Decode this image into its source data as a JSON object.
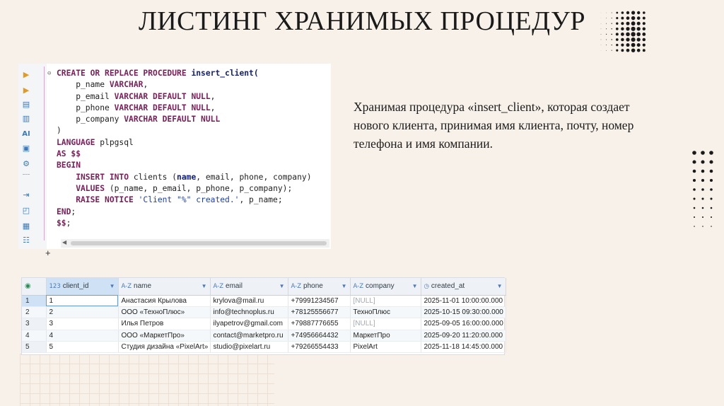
{
  "slide": {
    "title": "ЛИСТИНГ ХРАНИМЫХ ПРОЦЕДУР",
    "description": "Хранимая процедура «insert_client», которая создает нового клиента, принимая имя клиента, почту, номер телефона и имя компании."
  },
  "editor": {
    "toolbar_icons": [
      "execute-statement-icon",
      "execute-script-icon",
      "explain-plan-icon",
      "load-plan-icon",
      "ai-assistant-icon",
      "output-console-icon",
      "settings-icon",
      "export-icon",
      "variables-icon",
      "log-icon",
      "outline-icon"
    ],
    "ai_label": "AI",
    "code_lines": [
      [
        {
          "t": "CREATE OR REPLACE PROCEDURE ",
          "c": "kw"
        },
        {
          "t": "insert_client(",
          "c": "hl"
        }
      ],
      [
        {
          "t": "    p_name ",
          "c": "id"
        },
        {
          "t": "VARCHAR",
          "c": "kw"
        },
        {
          "t": ",",
          "c": "id"
        }
      ],
      [
        {
          "t": "    p_email ",
          "c": "id"
        },
        {
          "t": "VARCHAR DEFAULT NULL",
          "c": "kw"
        },
        {
          "t": ",",
          "c": "id"
        }
      ],
      [
        {
          "t": "    p_phone ",
          "c": "id"
        },
        {
          "t": "VARCHAR DEFAULT NULL",
          "c": "kw"
        },
        {
          "t": ",",
          "c": "id"
        }
      ],
      [
        {
          "t": "    p_company ",
          "c": "id"
        },
        {
          "t": "VARCHAR DEFAULT NULL",
          "c": "kw"
        }
      ],
      [
        {
          "t": ")",
          "c": "id"
        }
      ],
      [
        {
          "t": "LANGUAGE ",
          "c": "kw"
        },
        {
          "t": "plpgsql",
          "c": "id"
        }
      ],
      [
        {
          "t": "AS ",
          "c": "kw"
        },
        {
          "t": "$$",
          "c": "kw"
        }
      ],
      [
        {
          "t": "BEGIN",
          "c": "kw"
        }
      ],
      [
        {
          "t": "    INSERT INTO ",
          "c": "kw"
        },
        {
          "t": "clients (",
          "c": "id"
        },
        {
          "t": "name",
          "c": "hl"
        },
        {
          "t": ", email, phone, company)",
          "c": "id"
        }
      ],
      [
        {
          "t": "    VALUES ",
          "c": "kw"
        },
        {
          "t": "(p_name, p_email, p_phone, p_company);",
          "c": "id"
        }
      ],
      [
        {
          "t": "    RAISE NOTICE ",
          "c": "kw"
        },
        {
          "t": "'Client \"%\" created.'",
          "c": "str"
        },
        {
          "t": ", p_name;",
          "c": "id"
        }
      ],
      [
        {
          "t": "END",
          "c": "kw"
        },
        {
          "t": ";",
          "c": "id"
        }
      ],
      [
        {
          "t": "$$",
          "c": "kw"
        },
        {
          "t": ";",
          "c": "id"
        }
      ]
    ],
    "plus_mark": "+"
  },
  "result_grid": {
    "columns": [
      {
        "type": "123",
        "name": "client_id",
        "sorted": true
      },
      {
        "type": "A-Z",
        "name": "name"
      },
      {
        "type": "A-Z",
        "name": "email"
      },
      {
        "type": "A-Z",
        "name": "phone"
      },
      {
        "type": "A-Z",
        "name": "company"
      },
      {
        "type": "clock",
        "name": "created_at"
      }
    ],
    "rows": [
      {
        "n": "1",
        "cells": [
          "1",
          "Анастасия Крылова",
          "krylova@mail.ru",
          "+79991234567",
          "[NULL]",
          "2025-11-01 10:00:00.000"
        ]
      },
      {
        "n": "2",
        "cells": [
          "2",
          "ООО «ТехноПлюс»",
          "info@technoplus.ru",
          "+78125556677",
          "ТехноПлюс",
          "2025-10-15 09:30:00.000"
        ]
      },
      {
        "n": "3",
        "cells": [
          "3",
          "Илья Петров",
          "ilyapetrov@gmail.com",
          "+79887776655",
          "[NULL]",
          "2025-09-05 16:00:00.000"
        ]
      },
      {
        "n": "4",
        "cells": [
          "4",
          "ООО «МаркетПро»",
          "contact@marketpro.ru",
          "+74956664432",
          "МаркетПро",
          "2025-09-20 11:20:00.000"
        ]
      },
      {
        "n": "5",
        "cells": [
          "5",
          "Студия дизайна «PixelArt»",
          "studio@pixelart.ru",
          "+79266554433",
          "PixelArt",
          "2025-11-18 14:45:00.000"
        ]
      }
    ]
  },
  "colors": {
    "background": "#f8f1ea",
    "keyword": "#7b1e57",
    "string": "#1f3fb0",
    "header_accent": "#4d79b8"
  }
}
